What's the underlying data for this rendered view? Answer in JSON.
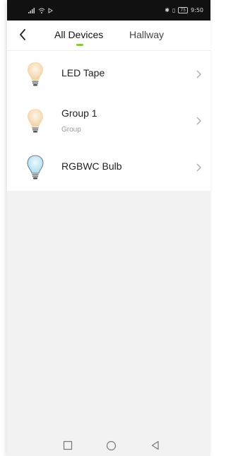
{
  "status_bar": {
    "left_icons": "signal-icon wifi-icon cast-icon",
    "battery": "75",
    "time": "9:50"
  },
  "header": {
    "tabs": [
      {
        "label": "All Devices",
        "active": true
      },
      {
        "label": "Hallway",
        "active": false
      }
    ]
  },
  "devices": [
    {
      "name": "LED Tape",
      "subtitle": "",
      "icon": "warm-bulb-icon"
    },
    {
      "name": "Group 1",
      "subtitle": "Group",
      "icon": "warm-bulb-icon"
    },
    {
      "name": "RGBWC Bulb",
      "subtitle": "",
      "icon": "blue-bulb-icon"
    }
  ],
  "colors": {
    "accent": "#8cc63f",
    "warm_bulb": "#f7d9b4",
    "blue_bulb": "#bfe6f7"
  }
}
